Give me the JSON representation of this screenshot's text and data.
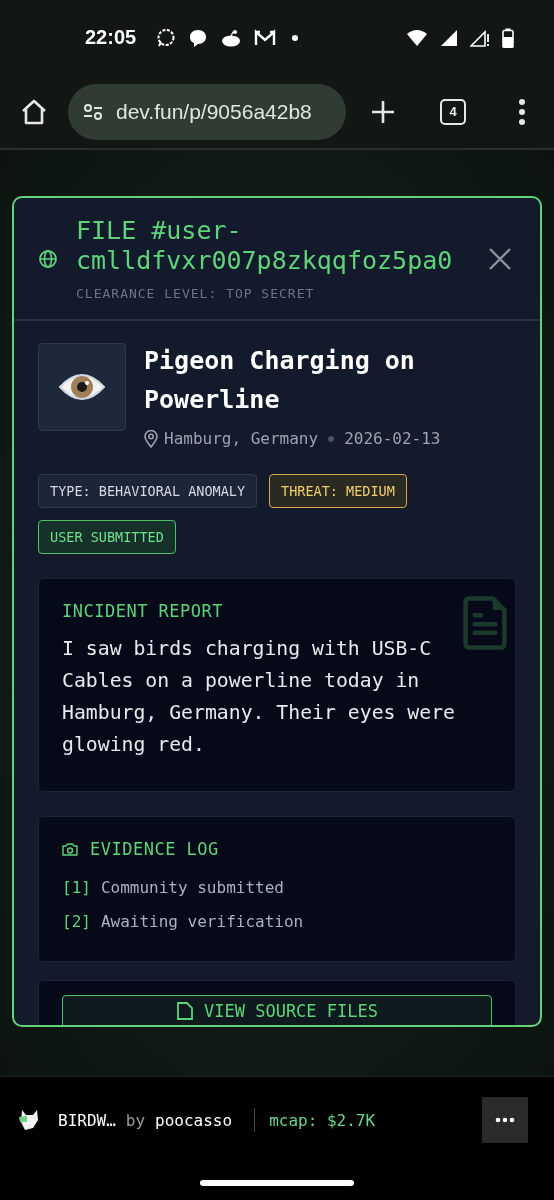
{
  "status_bar": {
    "time": "22:05"
  },
  "browser": {
    "url": "dev.fun/p/9056a42b8",
    "tab_count": "4"
  },
  "dossier": {
    "file_id": "FILE #user-cmlldfvxr007p8zkqqfoz5pa0",
    "clearance": "CLEARANCE LEVEL: TOP SECRET",
    "title": "Pigeon Charging on Powerline",
    "location": "Hamburg, Germany",
    "date": "2026-02-13",
    "tags": [
      {
        "label": "TYPE: BEHAVIORAL ANOMALY",
        "kind": "type"
      },
      {
        "label": "THREAT: MEDIUM",
        "kind": "threat"
      },
      {
        "label": "USER SUBMITTED",
        "kind": "source"
      }
    ],
    "incident": {
      "heading": "INCIDENT REPORT",
      "text": "I saw birds charging with USB-C Cables on a powerline today in Hamburg, Germany. Their eyes were glowing red."
    },
    "evidence": {
      "heading": "EVIDENCE LOG",
      "items": [
        {
          "index": "[1]",
          "text": "Community submitted"
        },
        {
          "index": "[2]",
          "text": "Awaiting verification"
        }
      ]
    },
    "button": "VIEW SOURCE FILES"
  },
  "footer": {
    "token": "BIRDW…",
    "by": "by",
    "author": "poocasso",
    "mcap": "mcap: $2.7K"
  }
}
